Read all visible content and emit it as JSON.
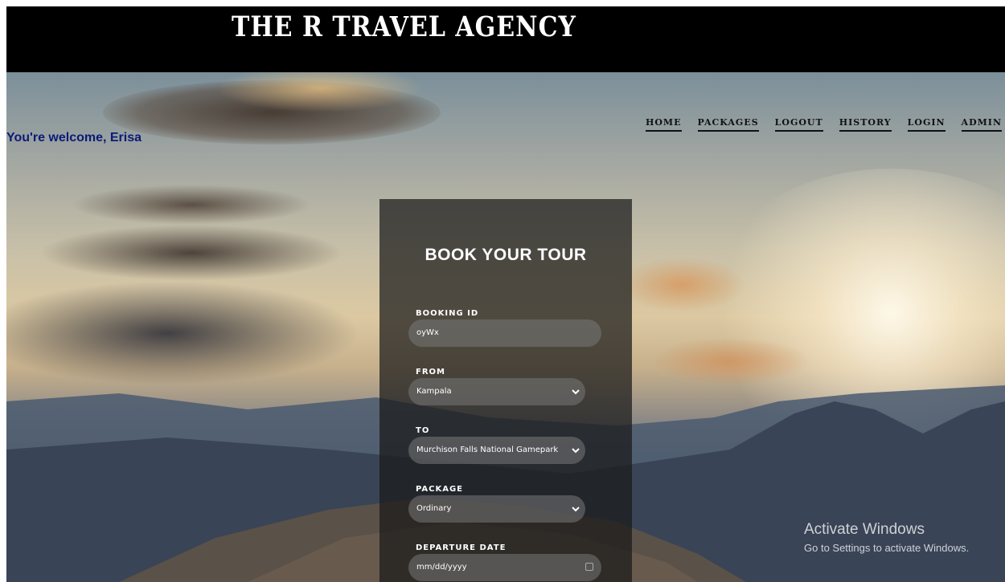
{
  "header": {
    "brand": "THE R TRAVEL AGENCY"
  },
  "welcome": "You're welcome, Erisa",
  "nav": [
    "HOME",
    "PACKAGES",
    "LOGOUT",
    "HISTORY",
    "LOGIN",
    "ADMIN"
  ],
  "form": {
    "title": "BOOK YOUR TOUR",
    "booking_id": {
      "label": "BOOKING ID",
      "value": "oyWx"
    },
    "from": {
      "label": "FROM",
      "value": "Kampala"
    },
    "to": {
      "label": "TO",
      "value": "Murchison Falls National Gamepark"
    },
    "package": {
      "label": "PACKAGE",
      "value": "Ordinary"
    },
    "departure_date": {
      "label": "DEPARTURE DATE",
      "placeholder": "mm/dd/yyyy"
    }
  },
  "watermark": {
    "title": "Activate Windows",
    "subtitle": "Go to Settings to activate Windows."
  }
}
